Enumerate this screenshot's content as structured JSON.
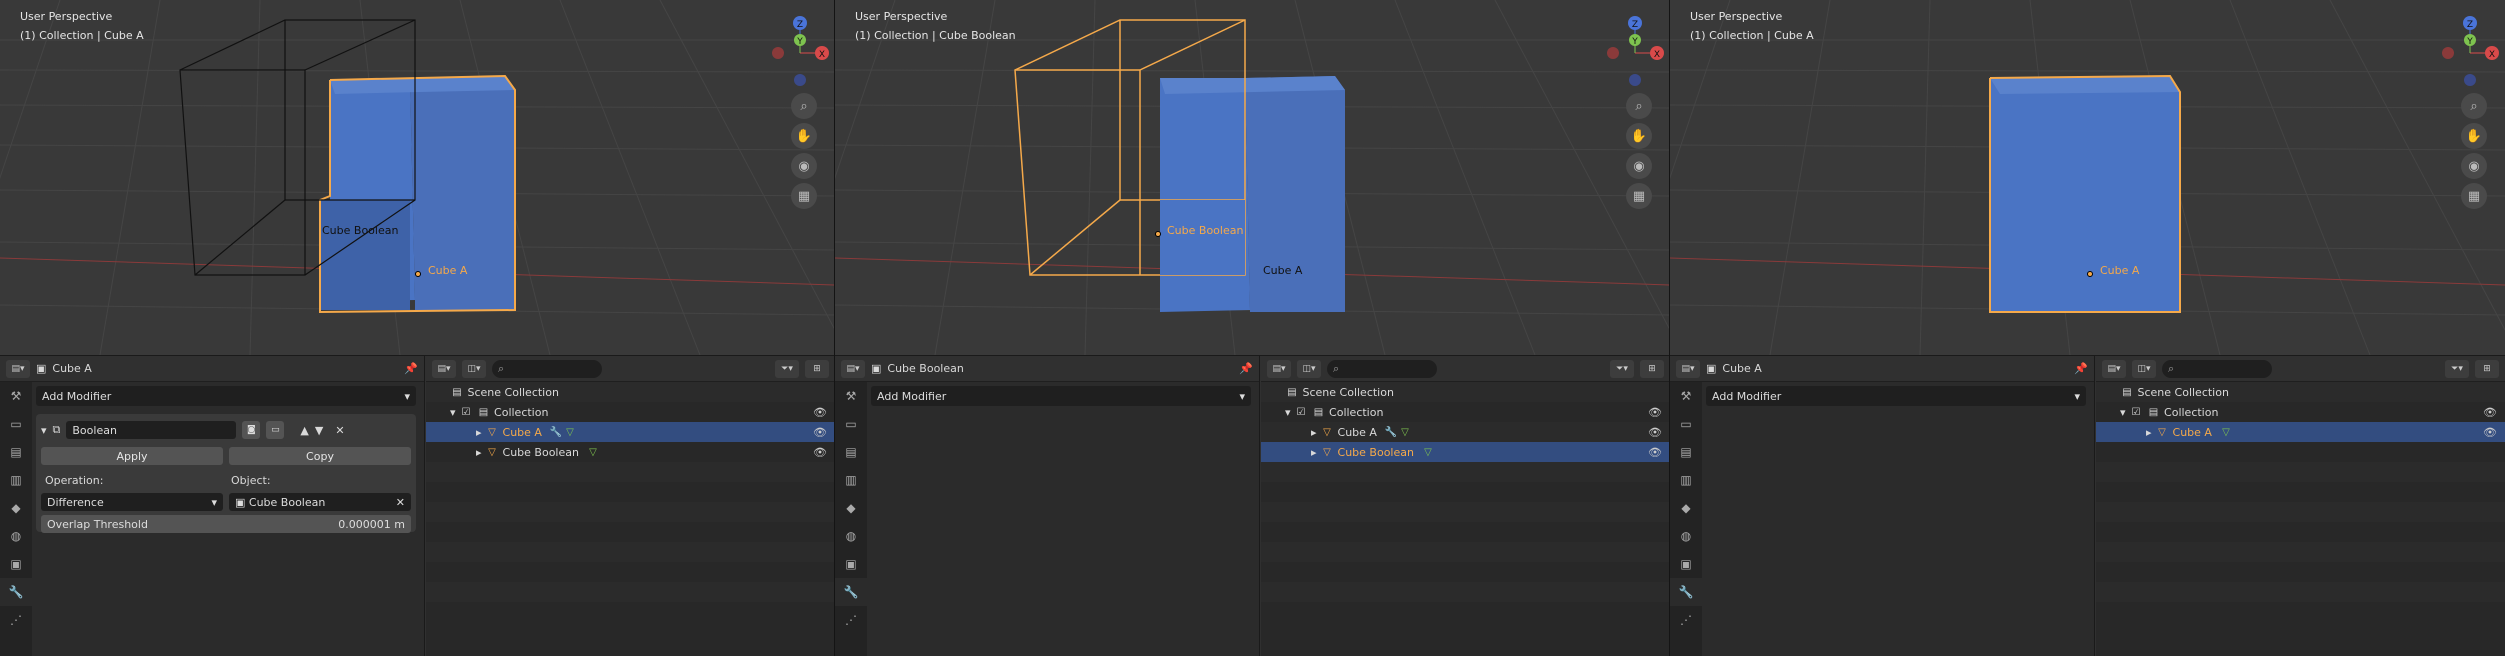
{
  "panels": [
    {
      "viewport": {
        "perspective": "User Perspective",
        "collection": "(1) Collection | Cube A",
        "label_boolean": "Cube Boolean",
        "label_a": "Cube A"
      },
      "properties": {
        "object_name": "Cube A",
        "add_modifier": "Add Modifier",
        "modifier": {
          "name": "Boolean",
          "apply": "Apply",
          "copy": "Copy",
          "operation_label": "Operation:",
          "object_label": "Object:",
          "operation_value": "Difference",
          "object_value": "Cube Boolean",
          "overlap_label": "Overlap Threshold",
          "overlap_value": "0.000001 m"
        }
      },
      "outliner": {
        "scene": "Scene Collection",
        "collection": "Collection",
        "items": [
          "Cube A",
          "Cube Boolean"
        ],
        "selected": 0
      }
    },
    {
      "viewport": {
        "perspective": "User Perspective",
        "collection": "(1) Collection | Cube Boolean",
        "label_boolean": "Cube Boolean",
        "label_a": "Cube A"
      },
      "properties": {
        "object_name": "Cube Boolean",
        "add_modifier": "Add Modifier"
      },
      "outliner": {
        "scene": "Scene Collection",
        "collection": "Collection",
        "items": [
          "Cube A",
          "Cube Boolean"
        ],
        "selected": 1
      }
    },
    {
      "viewport": {
        "perspective": "User Perspective",
        "collection": "(1) Collection | Cube A",
        "label_a": "Cube A"
      },
      "properties": {
        "object_name": "Cube A",
        "add_modifier": "Add Modifier"
      },
      "outliner": {
        "scene": "Scene Collection",
        "collection": "Collection",
        "items": [
          "Cube A"
        ],
        "selected": 0
      }
    }
  ],
  "gizmo": {
    "z": "Z",
    "y": "Y",
    "x": "X"
  },
  "colors": {
    "selected_outline": "#f5a94a",
    "cube_blue": "#4a74c4",
    "selection_row": "#334d80",
    "x_axis": "#d94a4a",
    "y_axis": "#7ec34f",
    "z_axis": "#4a74d9"
  }
}
